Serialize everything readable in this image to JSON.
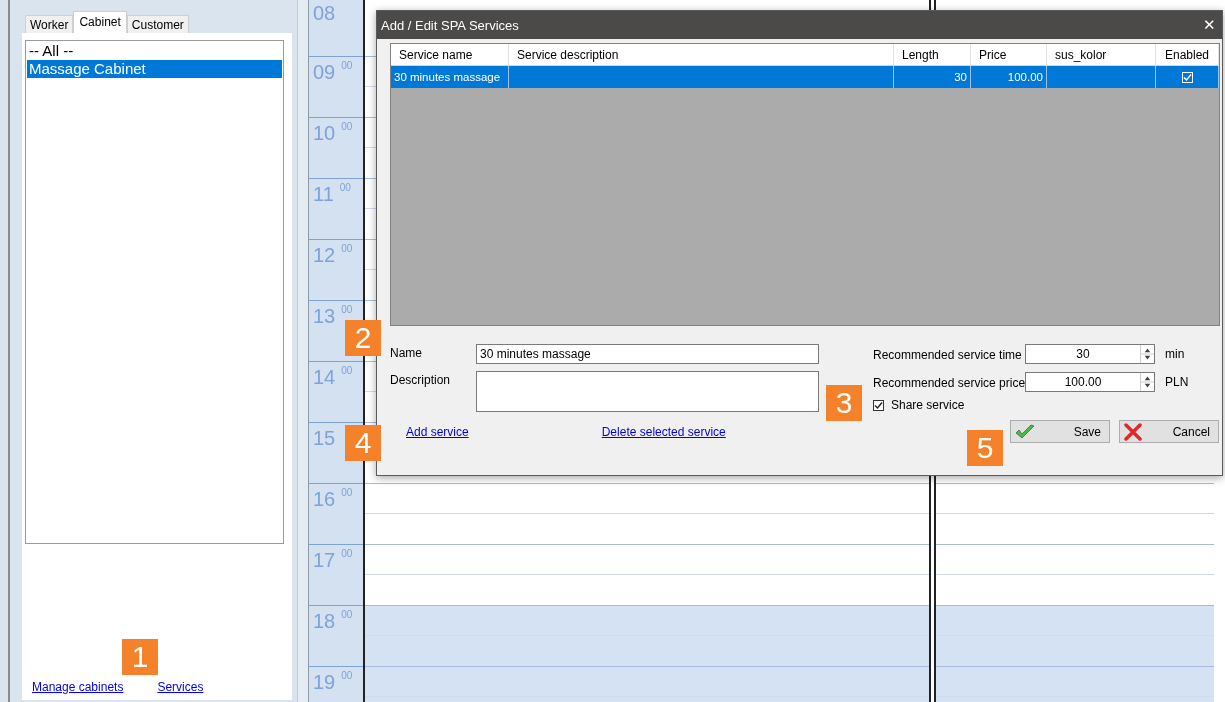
{
  "left_panel": {
    "tabs": [
      {
        "label": "Worker",
        "selected": false
      },
      {
        "label": "Cabinet",
        "selected": true
      },
      {
        "label": "Customer",
        "selected": false
      }
    ],
    "list_items": [
      {
        "label": "-- All --",
        "selected": false
      },
      {
        "label": "Massage Cabinet",
        "selected": true
      }
    ],
    "links": [
      "Manage cabinets",
      "Services"
    ]
  },
  "schedule": {
    "hours": [
      {
        "hour": "08",
        "shaded": false
      },
      {
        "hour": "09",
        "minutes": "00",
        "shaded": false
      },
      {
        "hour": "10",
        "minutes": "00",
        "shaded": false
      },
      {
        "hour": "11",
        "minutes": "00",
        "shaded": false
      },
      {
        "hour": "12",
        "minutes": "00",
        "shaded": false
      },
      {
        "hour": "13",
        "minutes": "00",
        "shaded": false
      },
      {
        "hour": "14",
        "minutes": "00",
        "shaded": false
      },
      {
        "hour": "15",
        "shaded": false
      },
      {
        "hour": "16",
        "minutes": "00",
        "shaded": false
      },
      {
        "hour": "17",
        "minutes": "00",
        "shaded": false
      },
      {
        "hour": "18",
        "minutes": "00",
        "shaded": true
      },
      {
        "hour": "19",
        "minutes": "00",
        "shaded": true
      }
    ]
  },
  "dialog": {
    "title": "Add / Edit SPA Services",
    "close": "✕",
    "table": {
      "columns": [
        "Service name",
        "Service description",
        "Length",
        "Price",
        "sus_kolor",
        "Enabled"
      ],
      "rows": [
        {
          "service_name": "30 minutes massage",
          "length": "30",
          "price": "100.00",
          "enabled": true,
          "selected": true
        }
      ]
    },
    "form": {
      "name_label": "Name",
      "name_value": "30 minutes massage",
      "description_label": "Description",
      "time_label": "Recommended service time",
      "time_value": "30",
      "time_unit": "min",
      "price_label": "Recommended service price",
      "price_value": "100.00",
      "price_unit": "PLN",
      "share_label": "Share service",
      "share_checked": true
    },
    "links": [
      "Add service",
      "Delete selected service"
    ],
    "buttons": [
      {
        "kind": "save",
        "label": "Save"
      },
      {
        "kind": "cancel",
        "label": "Cancel"
      }
    ]
  },
  "annotations": [
    "1",
    "2",
    "3",
    "4",
    "5"
  ]
}
